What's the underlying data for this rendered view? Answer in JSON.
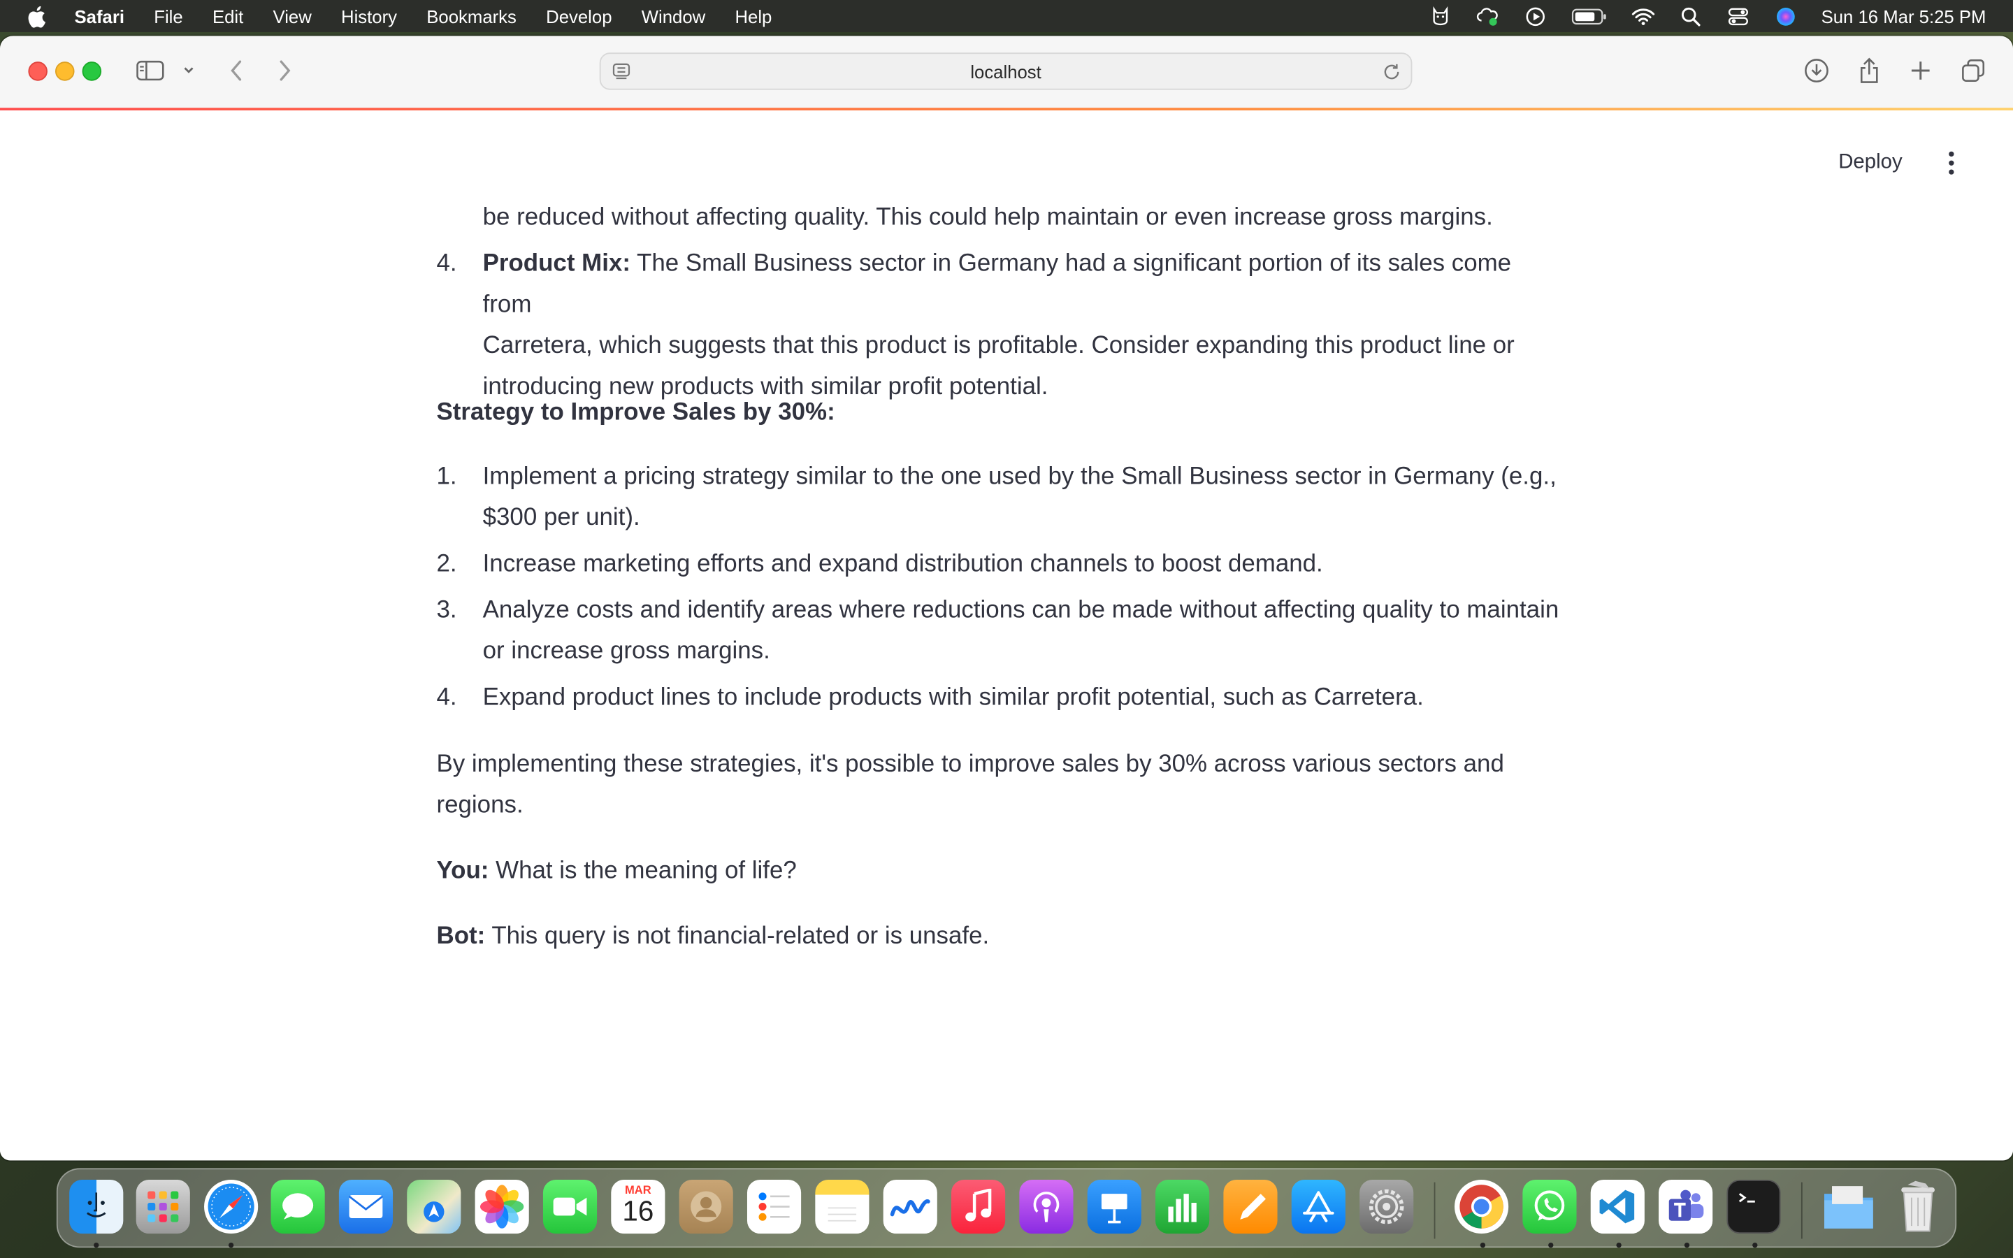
{
  "menubar": {
    "apple_icon": "apple-logo-icon",
    "app_name": "Safari",
    "items": [
      "File",
      "Edit",
      "View",
      "History",
      "Bookmarks",
      "Develop",
      "Window",
      "Help"
    ],
    "status_icons": [
      "cat-icon",
      "cloud-sync-icon",
      "play-circle-icon",
      "battery-icon",
      "wifi-icon",
      "search-icon",
      "control-center-icon",
      "siri-icon"
    ],
    "clock": "Sun 16 Mar  5:25 PM"
  },
  "toolbar": {
    "address": "localhost"
  },
  "app": {
    "deploy_label": "Deploy"
  },
  "content": {
    "continuation": "be reduced without affecting quality. This could help maintain or even increase gross margins.",
    "item4_num": "4.",
    "item4_bold": "Product Mix:",
    "item4_line1": " The Small Business sector in Germany had a significant portion of its sales come from",
    "item4_line2": "Carretera, which suggests that this product is profitable. Consider expanding this product line or",
    "item4_line3": "introducing new products with similar profit potential.",
    "strategy_heading": "Strategy to Improve Sales by 30%:",
    "strategy_items": [
      {
        "num": "1.",
        "line1": "Implement a pricing strategy similar to the one used by the Small Business sector in Germany (e.g.,",
        "line2": "$300 per unit)."
      },
      {
        "num": "2.",
        "line1": "Increase marketing efforts and expand distribution channels to boost demand."
      },
      {
        "num": "3.",
        "line1": "Analyze costs and identify areas where reductions can be made without affecting quality to maintain",
        "line2": "or increase gross margins."
      },
      {
        "num": "4.",
        "line1": "Expand product lines to include products with similar profit potential, such as Carretera."
      }
    ],
    "conclusion_line1": "By implementing these strategies, it's possible to improve sales by 30% across various sectors and",
    "conclusion_line2": "regions.",
    "you_label": "You:",
    "you_text": " What is the meaning of life?",
    "bot_label": "Bot:",
    "bot_text": " This query is not financial-related or is unsafe."
  },
  "dock": {
    "calendar_month": "MAR",
    "calendar_day": "16",
    "apps": [
      "Finder",
      "Launchpad",
      "Safari",
      "Messages",
      "Mail",
      "Maps",
      "Photos",
      "FaceTime",
      "Calendar",
      "Contacts",
      "Reminders",
      "Notes",
      "Freeform",
      "Music",
      "Podcasts",
      "Keynote",
      "Numbers",
      "Pages",
      "App Store",
      "System Settings",
      "Chrome",
      "WhatsApp",
      "VS Code",
      "Teams",
      "Terminal",
      "Downloads",
      "Trash"
    ]
  }
}
